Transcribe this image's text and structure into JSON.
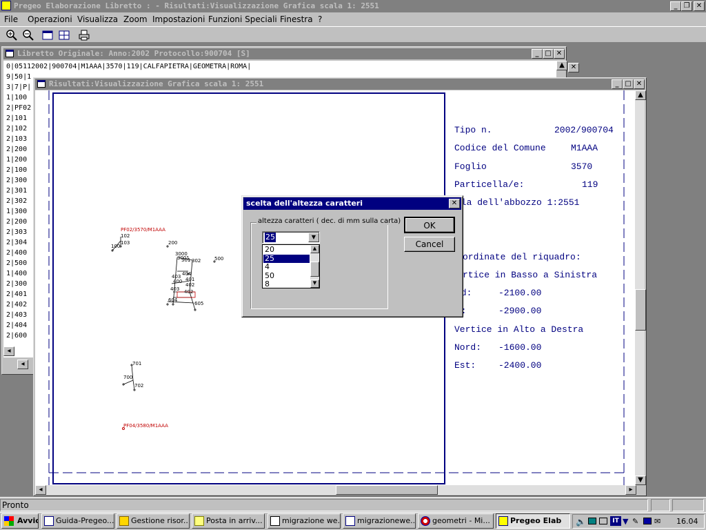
{
  "app": {
    "title": "Pregeo Elaborazione Libretto : -  Risultati:Visualizzazione Grafica scala 1:  2551"
  },
  "menu": [
    "File",
    "Operazioni",
    "Visualizza",
    "Zoom",
    "Impostazioni",
    "Funzioni Speciali",
    "Finestra",
    "?"
  ],
  "toolbar": [
    "zoom-in-icon",
    "zoom-out-icon",
    "window-icon",
    "grid-window-icon",
    "print-icon"
  ],
  "libretto": {
    "title": "Libretto Originale: Anno:2002 Protocollo:900704 [S]",
    "first_line": "0|05112002|900704|M1AAA|3570|119|CALFAPIETRA|GEOMETRA|ROMA|",
    "lines": [
      "9|50|1",
      "3|7|P|",
      "1|100",
      "2|PF02",
      "2|101",
      "2|102",
      "2|103",
      "2|200",
      "1|200",
      "2|100",
      "2|300",
      "2|301",
      "2|302",
      "1|300",
      "2|200",
      "2|303",
      "2|304",
      "2|400",
      "2|500",
      "1|400",
      "2|300",
      "2|401",
      "2|402",
      "2|403",
      "2|404",
      "2|600"
    ]
  },
  "risultati": {
    "title": "Risultati:Visualizzazione Grafica scala 1:  2551",
    "info": {
      "tipo_label": "Tipo n.",
      "tipo_value": "2002/900704",
      "comune_label": "Codice del Comune",
      "comune_value": "M1AAA",
      "foglio_label": "Foglio",
      "foglio_value": "3570",
      "particella_label": "Particella/e:",
      "particella_value": "119",
      "scala": "ala dell'abbozzo 1:2551",
      "coord_title": "ordinate del riquadro:",
      "basso_title": "rtice in Basso a Sinistra",
      "basso_nord_label": "rd:",
      "basso_nord": "-2100.00",
      "basso_est_label": "t:",
      "basso_est": "-2900.00",
      "alto_title": "Vertice in Alto a Destra",
      "alto_nord_label": "Nord:",
      "alto_nord": "-1600.00",
      "alto_est_label": "Est:",
      "alto_est": "-2400.00"
    },
    "plot_labels": {
      "pf02": "PF02/3570/M1AAA",
      "pf04": "PF04/3580/M1AAA",
      "points": [
        "102",
        "103",
        "100",
        "200",
        "3000",
        "3001",
        "301",
        "302",
        "500",
        "404",
        "403",
        "401",
        "400",
        "402",
        "403",
        "402",
        "604",
        "605",
        "701",
        "700",
        "702",
        "101"
      ]
    }
  },
  "dialog": {
    "title": "scelta dell'altezza caratteri",
    "group_label": "altezza caratteri ( dec. di mm sulla carta)",
    "combo_value": "25",
    "list_items": [
      "20",
      "25",
      "4",
      "50",
      "8"
    ],
    "selected": "25",
    "ok": "OK",
    "cancel": "Cancel"
  },
  "status": "Pronto",
  "taskbar": {
    "start": "Avvio",
    "tasks": [
      "Guida-Pregeo...",
      "Gestione risor...",
      "Posta in arriv...",
      "migrazione we...",
      "migrazionewe...",
      "geometri - Mi...",
      "Pregeo Elab"
    ],
    "clock": "16.04"
  },
  "colors": {
    "navy": "#000080",
    "face": "#c0c0c0",
    "red": "#c00000"
  }
}
